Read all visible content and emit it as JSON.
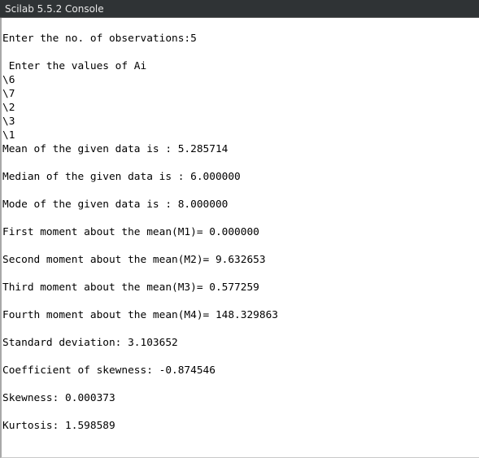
{
  "window": {
    "title": "Scilab 5.5.2 Console"
  },
  "console": {
    "lines": [
      "Enter the no. of observations:5",
      "",
      " Enter the values of Ai",
      "\\6",
      "\\7",
      "\\2",
      "\\3",
      "\\1",
      "Mean of the given data is : 5.285714",
      "",
      "Median of the given data is : 6.000000",
      "",
      "Mode of the given data is : 8.000000",
      "",
      "First moment about the mean(M1)= 0.000000",
      "",
      "Second moment about the mean(M2)= 9.632653",
      "",
      "Third moment about the mean(M3)= 0.577259",
      "",
      "Fourth moment about the mean(M4)= 148.329863",
      "",
      "Standard deviation: 3.103652",
      "",
      "Coefficient of skewness: -0.874546",
      "",
      "Skewness: 0.000373",
      "",
      "Kurtosis: 1.598589"
    ]
  }
}
